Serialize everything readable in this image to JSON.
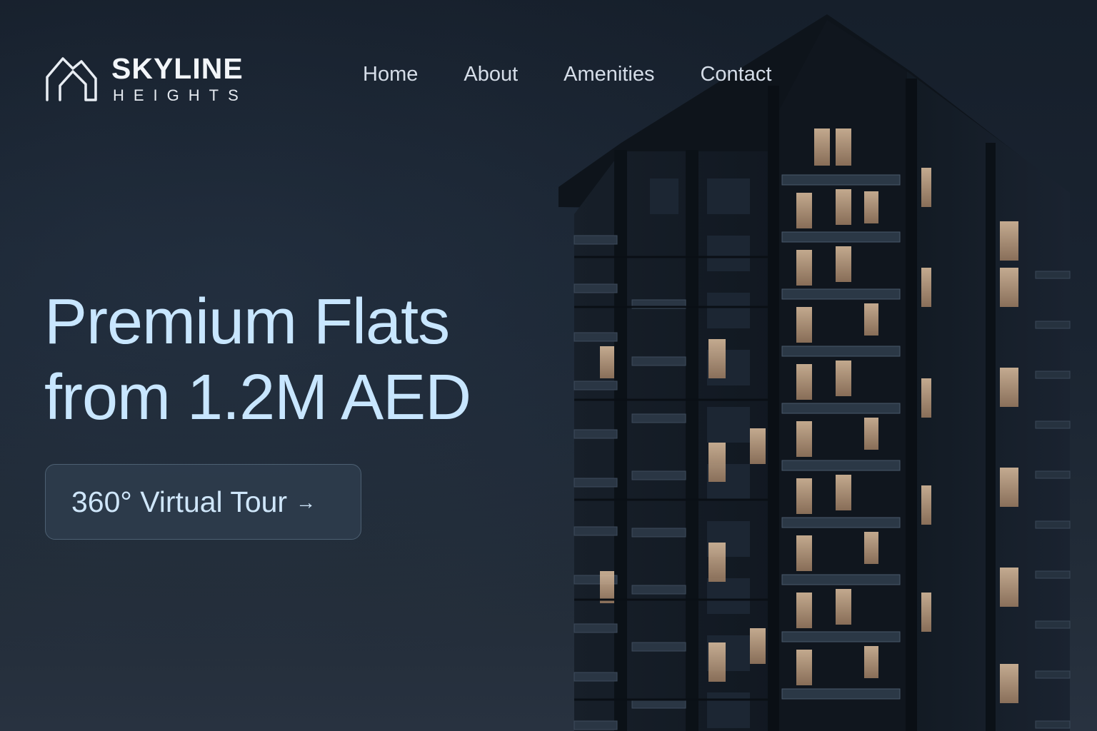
{
  "brand": {
    "name_top": "SKYLINE",
    "name_bottom": "HEIGHTS",
    "logo_icon": "mountain-roof-outline-icon"
  },
  "nav": {
    "items": [
      {
        "label": "Home"
      },
      {
        "label": "About"
      },
      {
        "label": "Amenities"
      },
      {
        "label": "Contact"
      }
    ]
  },
  "hero": {
    "headline_line1": "Premium Flats",
    "headline_line2": "from 1.2M AED",
    "cta_label": "360° Virtual Tour",
    "cta_icon": "arrow-right-icon",
    "image": "night-apartment-tower-photo"
  },
  "colors": {
    "background": "#1a2431",
    "headline": "#c8e6ff",
    "nav_text": "#d5dde8",
    "cta_border": "#4d6072",
    "window_light": "#d9b48f"
  }
}
